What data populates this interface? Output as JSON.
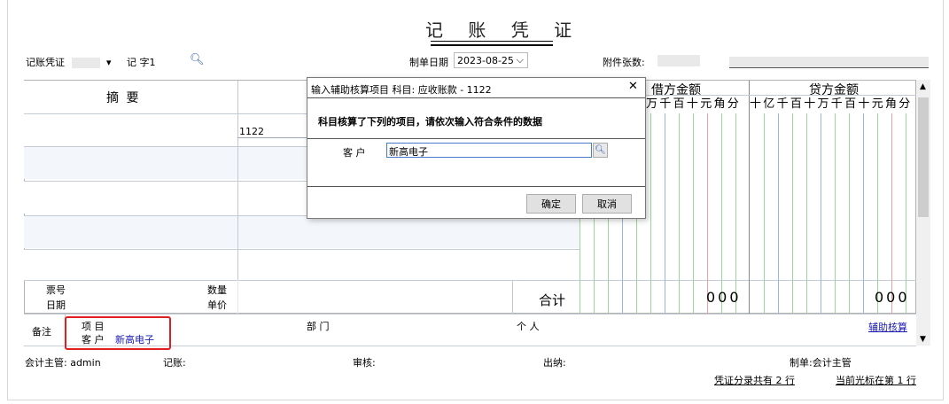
{
  "window": {
    "title": "记 账 凭 证"
  },
  "header": {
    "voucher_type": "记账凭证",
    "voucher_word": "记 字1",
    "date_label": "制单日期",
    "date_value": "2023-08-25",
    "attachments_label": "附件张数:"
  },
  "table": {
    "summary_header": "摘    要",
    "debit_header": "借方金额",
    "credit_header": "贷方金额",
    "units_debit": "万千百十元角分",
    "units_credit": "十亿千百十万千百十元角分",
    "row1_account_code": "1122"
  },
  "footer_rows": {
    "ticket_no": "票号",
    "date": "日期",
    "quantity": "数量",
    "unit_price": "单价",
    "total_label": "合计",
    "debit_total": "000",
    "credit_total": "000",
    "remarks": "备注",
    "project": "项 目",
    "customer_label": "客 户",
    "customer_value": "新高电子",
    "department": "部 门",
    "individual": "个 人",
    "aux_button": "辅助核算"
  },
  "signatures": {
    "supervisor": "会计主管: admin",
    "bookkeeper": "记账:",
    "auditor": "审核:",
    "cashier": "出纳:",
    "preparer": "制单:会计主管",
    "entries_count": "凭证分录共有 2 行",
    "cursor_position": "当前光标在第 1 行"
  },
  "dialog": {
    "title": "输入辅助核算项目 科目: 应收账款 - 1122",
    "message": "科目核算了下列的项目，请依次输入符合条件的数据",
    "customer_label": "客    户",
    "customer_value": "新高电子",
    "ok": "确定",
    "cancel": "取消",
    "close": "✕"
  },
  "colors": {
    "highlight": "#e02020",
    "customer_text": "#1a1ab8"
  }
}
